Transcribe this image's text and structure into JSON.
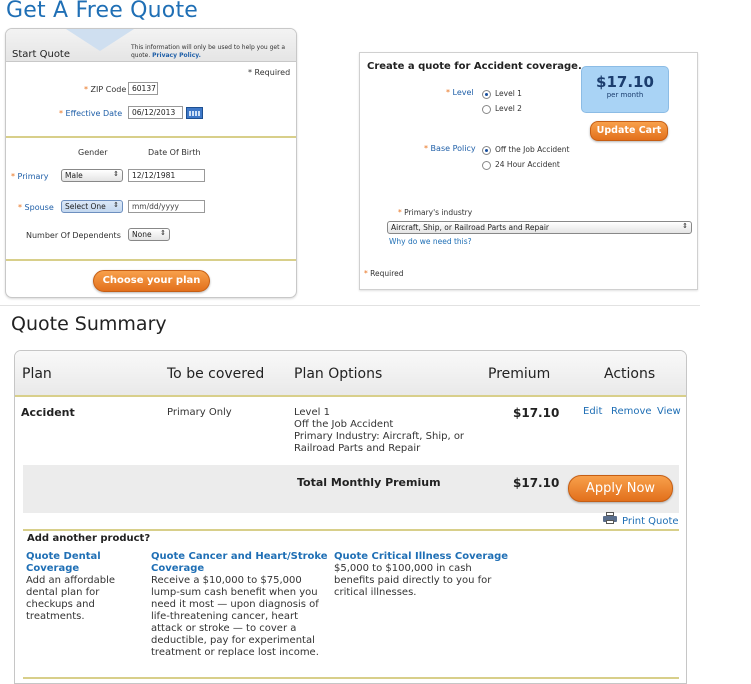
{
  "page": {
    "title": "Get A Free Quote"
  },
  "start_quote": {
    "title": "Start Quote",
    "note_text": "This information will only be used to help you get a quote.",
    "privacy_link": "Privacy Policy.",
    "required": "* Required",
    "zip_label": "ZIP Code",
    "zip_value": "60137",
    "date_label": "Effective Date",
    "date_value": "06/12/2013",
    "col_gender": "Gender",
    "col_dob": "Date Of Birth",
    "primary_label": "Primary",
    "primary_gender": "Male",
    "primary_dob": "12/12/1981",
    "spouse_label": "Spouse",
    "spouse_gender": "Select One",
    "spouse_dob_placeholder": "mm/dd/yyyy",
    "dependents_label": "Number Of Dependents",
    "dependents_value": "None",
    "choose_button": "Choose your plan"
  },
  "accident": {
    "title": "Create a quote for Accident coverage.",
    "level_label": "Level",
    "level_options": [
      "Level 1",
      "Level 2"
    ],
    "price": "$17.10",
    "per": "per month",
    "update_button": "Update Cart",
    "base_label": "Base Policy",
    "base_options": [
      "Off the Job Accident",
      "24 Hour Accident"
    ],
    "industry_label": "Primary's industry",
    "industry_value": "Aircraft, Ship, or Railroad Parts and Repair",
    "why_link": "Why do we need this?",
    "required": "Required"
  },
  "summary": {
    "title": "Quote Summary",
    "headers": [
      "Plan",
      "To be covered",
      "Plan Options",
      "Premium",
      "Actions"
    ],
    "row": {
      "plan": "Accident",
      "covered": "Primary Only",
      "options": [
        "Level 1",
        "Off the Job Accident",
        "Primary Industry: Aircraft, Ship, or",
        "Railroad Parts and Repair"
      ],
      "premium": "$17.10",
      "actions": [
        "Edit",
        "Remove",
        "View"
      ]
    },
    "total_label": "Total Monthly Premium",
    "total_value": "$17.10",
    "apply_button": "Apply Now",
    "print_link": "Print Quote",
    "add_title": "Add another product?",
    "products": [
      {
        "title": [
          "Quote Dental",
          "Coverage"
        ],
        "desc": [
          "Add an affordable",
          "dental plan for",
          "checkups and",
          "treatments."
        ]
      },
      {
        "title": [
          "Quote Cancer and Heart/Stroke",
          "Coverage"
        ],
        "desc": [
          "Receive a $10,000 to $75,000",
          "lump-sum cash benefit when you",
          "need it most — upon diagnosis of",
          "life-threatening cancer, heart",
          "attack or stroke — to cover a",
          "deductible, pay for experimental",
          "treatment or replace lost income."
        ]
      },
      {
        "title": [
          "Quote Critical Illness Coverage"
        ],
        "desc": [
          "$5,000 to $100,000 in cash",
          "benefits paid directly to you for",
          "critical illnesses."
        ]
      }
    ]
  }
}
